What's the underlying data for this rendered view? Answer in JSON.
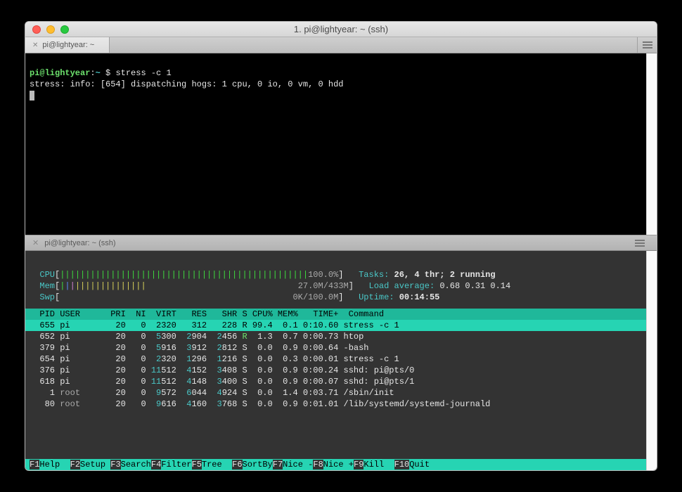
{
  "window": {
    "title": "1. pi@lightyear: ~ (ssh)",
    "tab_label": "pi@lightyear: ~"
  },
  "top_pane": {
    "prompt_user": "pi@lightyear",
    "prompt_path": "~",
    "prompt_symbol": "$",
    "command": "stress -c 1",
    "output_line": "stress: info: [654] dispatching hogs: 1 cpu, 0 io, 0 vm, 0 hdd"
  },
  "separator": {
    "label": "pi@lightyear: ~ (ssh)"
  },
  "htop": {
    "cpu": {
      "label": "CPU",
      "pct": "100.0%"
    },
    "mem": {
      "label": "Mem",
      "value": "27.0M/433M"
    },
    "swp": {
      "label": "Swp",
      "value": "0K/100.0M"
    },
    "tasks_label": "Tasks:",
    "tasks_value": "26, 4 thr; 2 running",
    "tasks_running_highlight": "2",
    "load_label": "Load average:",
    "load_value": "0.68 0.31 0.14",
    "uptime_label": "Uptime:",
    "uptime_value": "00:14:55",
    "columns": "  PID USER      PRI  NI  VIRT   RES   SHR S CPU% MEM%   TIME+  Command",
    "rows": [
      {
        "pid": "655",
        "user": "pi",
        "pri": "20",
        "ni": "0",
        "virt": "2320",
        "res": "312",
        "shr": "228",
        "s": "R",
        "cpu": "99.4",
        "mem": "0.1",
        "time": "0:10.60",
        "cmd": "stress -c 1",
        "sel": true
      },
      {
        "pid": "652",
        "user": "pi",
        "pri": "20",
        "ni": "0",
        "virt": "5300",
        "res": "2904",
        "shr": "2456",
        "s": "R",
        "cpu": "1.3",
        "mem": "0.7",
        "time": "0:00.73",
        "cmd": "htop"
      },
      {
        "pid": "379",
        "user": "pi",
        "pri": "20",
        "ni": "0",
        "virt": "5916",
        "res": "3912",
        "shr": "2812",
        "s": "S",
        "cpu": "0.0",
        "mem": "0.9",
        "time": "0:00.64",
        "cmd": "-bash"
      },
      {
        "pid": "654",
        "user": "pi",
        "pri": "20",
        "ni": "0",
        "virt": "2320",
        "res": "1296",
        "shr": "1216",
        "s": "S",
        "cpu": "0.0",
        "mem": "0.3",
        "time": "0:00.01",
        "cmd": "stress -c 1"
      },
      {
        "pid": "376",
        "user": "pi",
        "pri": "20",
        "ni": "0",
        "virt": "11512",
        "res": "4152",
        "shr": "3408",
        "s": "S",
        "cpu": "0.0",
        "mem": "0.9",
        "time": "0:00.24",
        "cmd": "sshd: pi@pts/0"
      },
      {
        "pid": "618",
        "user": "pi",
        "pri": "20",
        "ni": "0",
        "virt": "11512",
        "res": "4148",
        "shr": "3400",
        "s": "S",
        "cpu": "0.0",
        "mem": "0.9",
        "time": "0:00.07",
        "cmd": "sshd: pi@pts/1"
      },
      {
        "pid": "1",
        "user": "root",
        "pri": "20",
        "ni": "0",
        "virt": "9572",
        "res": "6044",
        "shr": "4924",
        "s": "S",
        "cpu": "0.0",
        "mem": "1.4",
        "time": "0:03.71",
        "cmd": "/sbin/init"
      },
      {
        "pid": "80",
        "user": "root",
        "pri": "20",
        "ni": "0",
        "virt": "9616",
        "res": "4160",
        "shr": "3768",
        "s": "S",
        "cpu": "0.0",
        "mem": "0.9",
        "time": "0:01.01",
        "cmd": "/lib/systemd/systemd-journald"
      }
    ],
    "fkeys": [
      {
        "k": "F1",
        "l": "Help  "
      },
      {
        "k": "F2",
        "l": "Setup "
      },
      {
        "k": "F3",
        "l": "Search"
      },
      {
        "k": "F4",
        "l": "Filter"
      },
      {
        "k": "F5",
        "l": "Tree  "
      },
      {
        "k": "F6",
        "l": "SortBy"
      },
      {
        "k": "F7",
        "l": "Nice -"
      },
      {
        "k": "F8",
        "l": "Nice +"
      },
      {
        "k": "F9",
        "l": "Kill  "
      },
      {
        "k": "F10",
        "l": "Quit  "
      }
    ]
  }
}
